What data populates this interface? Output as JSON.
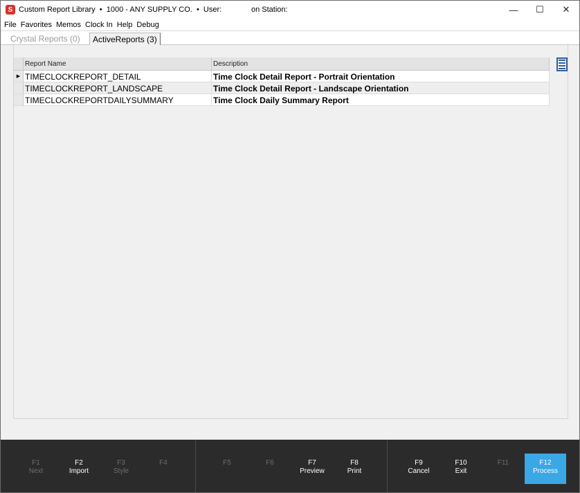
{
  "titlebar": {
    "app_icon_letter": "S",
    "title": "Custom Report Library  •  1000 - ANY SUPPLY CO.  •  User:              on Station:",
    "minimize": "—",
    "maximize": "☐",
    "close": "✕"
  },
  "menu": [
    "File",
    "Favorites",
    "Memos",
    "Clock In",
    "Help",
    "Debug"
  ],
  "tabs": {
    "crystal": "Crystal Reports (0)",
    "active": "ActiveReports (3)"
  },
  "grid": {
    "columns": [
      "Report Name",
      "Description"
    ],
    "rows": [
      {
        "name": "TIMECLOCKREPORT_DETAIL",
        "description": "Time Clock Detail Report - Portrait Orientation",
        "current": true
      },
      {
        "name": "TIMECLOCKREPORT_LANDSCAPE",
        "description": "Time Clock Detail Report - Landscape Orientation",
        "current": false
      },
      {
        "name": "TIMECLOCKREPORTDAILYSUMMARY",
        "description": "Time Clock Daily Summary Report",
        "current": false
      }
    ],
    "current_marker": "▶"
  },
  "fkeys": [
    {
      "key": "F1",
      "label": "Next",
      "state": "disabled"
    },
    {
      "key": "F2",
      "label": "Import",
      "state": "enabled"
    },
    {
      "key": "F3",
      "label": "Style",
      "state": "disabled"
    },
    {
      "key": "F4",
      "label": "",
      "state": "disabled"
    },
    {
      "key": "F5",
      "label": "",
      "state": "disabled"
    },
    {
      "key": "F6",
      "label": "",
      "state": "disabled"
    },
    {
      "key": "F7",
      "label": "Preview",
      "state": "enabled"
    },
    {
      "key": "F8",
      "label": "Print",
      "state": "enabled"
    },
    {
      "key": "F9",
      "label": "Cancel",
      "state": "enabled"
    },
    {
      "key": "F10",
      "label": "Exit",
      "state": "enabled"
    },
    {
      "key": "F11",
      "label": "",
      "state": "disabled"
    },
    {
      "key": "F12",
      "label": "Process",
      "state": "primary"
    }
  ],
  "colors": {
    "accent": "#3aa7e6",
    "app_icon": "#d9302c",
    "footer_bg": "#2b2b2b"
  }
}
